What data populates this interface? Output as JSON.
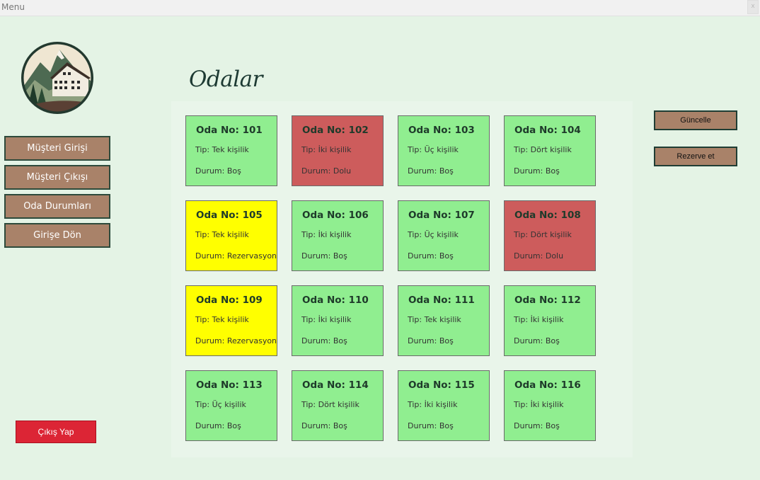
{
  "window": {
    "title": "Menu",
    "close_label": "x"
  },
  "sidebar": {
    "items": [
      {
        "label": "Müşteri Girişi"
      },
      {
        "label": "Müşteri Çıkışı"
      },
      {
        "label": "Oda Durumları"
      },
      {
        "label": "Girişe Dön"
      }
    ],
    "exit_label": "Çıkış Yap"
  },
  "main": {
    "title": "Odalar"
  },
  "actions": {
    "update_label": "Güncelle",
    "reserve_label": "Rezerve et"
  },
  "colors": {
    "available": "#90ee90",
    "occupied": "#cd5c5c",
    "reserved": "#ffff00",
    "button": "#a98269",
    "exit": "#dc2535"
  },
  "rooms": [
    {
      "no": "Oda No: 101",
      "tip": "Tip: Tek kişilik",
      "durum": "Durum: Boş",
      "status": "available"
    },
    {
      "no": "Oda No: 102",
      "tip": "Tip: İki kişilik",
      "durum": "Durum: Dolu",
      "status": "occupied"
    },
    {
      "no": "Oda No: 103",
      "tip": "Tip: Üç kişilik",
      "durum": "Durum: Boş",
      "status": "available"
    },
    {
      "no": "Oda No: 104",
      "tip": "Tip: Dört kişilik",
      "durum": "Durum: Boş",
      "status": "available"
    },
    {
      "no": "Oda No: 105",
      "tip": "Tip: Tek kişilik",
      "durum": "Durum: Rezervasyon",
      "status": "reserved"
    },
    {
      "no": "Oda No: 106",
      "tip": "Tip: İki kişilik",
      "durum": "Durum: Boş",
      "status": "available"
    },
    {
      "no": "Oda No: 107",
      "tip": "Tip: Üç kişilik",
      "durum": "Durum: Boş",
      "status": "available"
    },
    {
      "no": "Oda No: 108",
      "tip": "Tip: Dört kişilik",
      "durum": "Durum: Dolu",
      "status": "occupied"
    },
    {
      "no": "Oda No: 109",
      "tip": "Tip: Tek kişilik",
      "durum": "Durum: Rezervasyon",
      "status": "reserved"
    },
    {
      "no": "Oda No: 110",
      "tip": "Tip: İki kişilik",
      "durum": "Durum: Boş",
      "status": "available"
    },
    {
      "no": "Oda No: 111",
      "tip": "Tip: Tek kişilik",
      "durum": "Durum: Boş",
      "status": "available"
    },
    {
      "no": "Oda No: 112",
      "tip": "Tip: İki kişilik",
      "durum": "Durum: Boş",
      "status": "available"
    },
    {
      "no": "Oda No: 113",
      "tip": "Tip: Üç kişilik",
      "durum": "Durum: Boş",
      "status": "available"
    },
    {
      "no": "Oda No: 114",
      "tip": "Tip: Dört kişilik",
      "durum": "Durum: Boş",
      "status": "available"
    },
    {
      "no": "Oda No: 115",
      "tip": "Tip: İki kişilik",
      "durum": "Durum: Boş",
      "status": "available"
    },
    {
      "no": "Oda No: 116",
      "tip": "Tip: İki kişilik",
      "durum": "Durum: Boş",
      "status": "available"
    }
  ]
}
